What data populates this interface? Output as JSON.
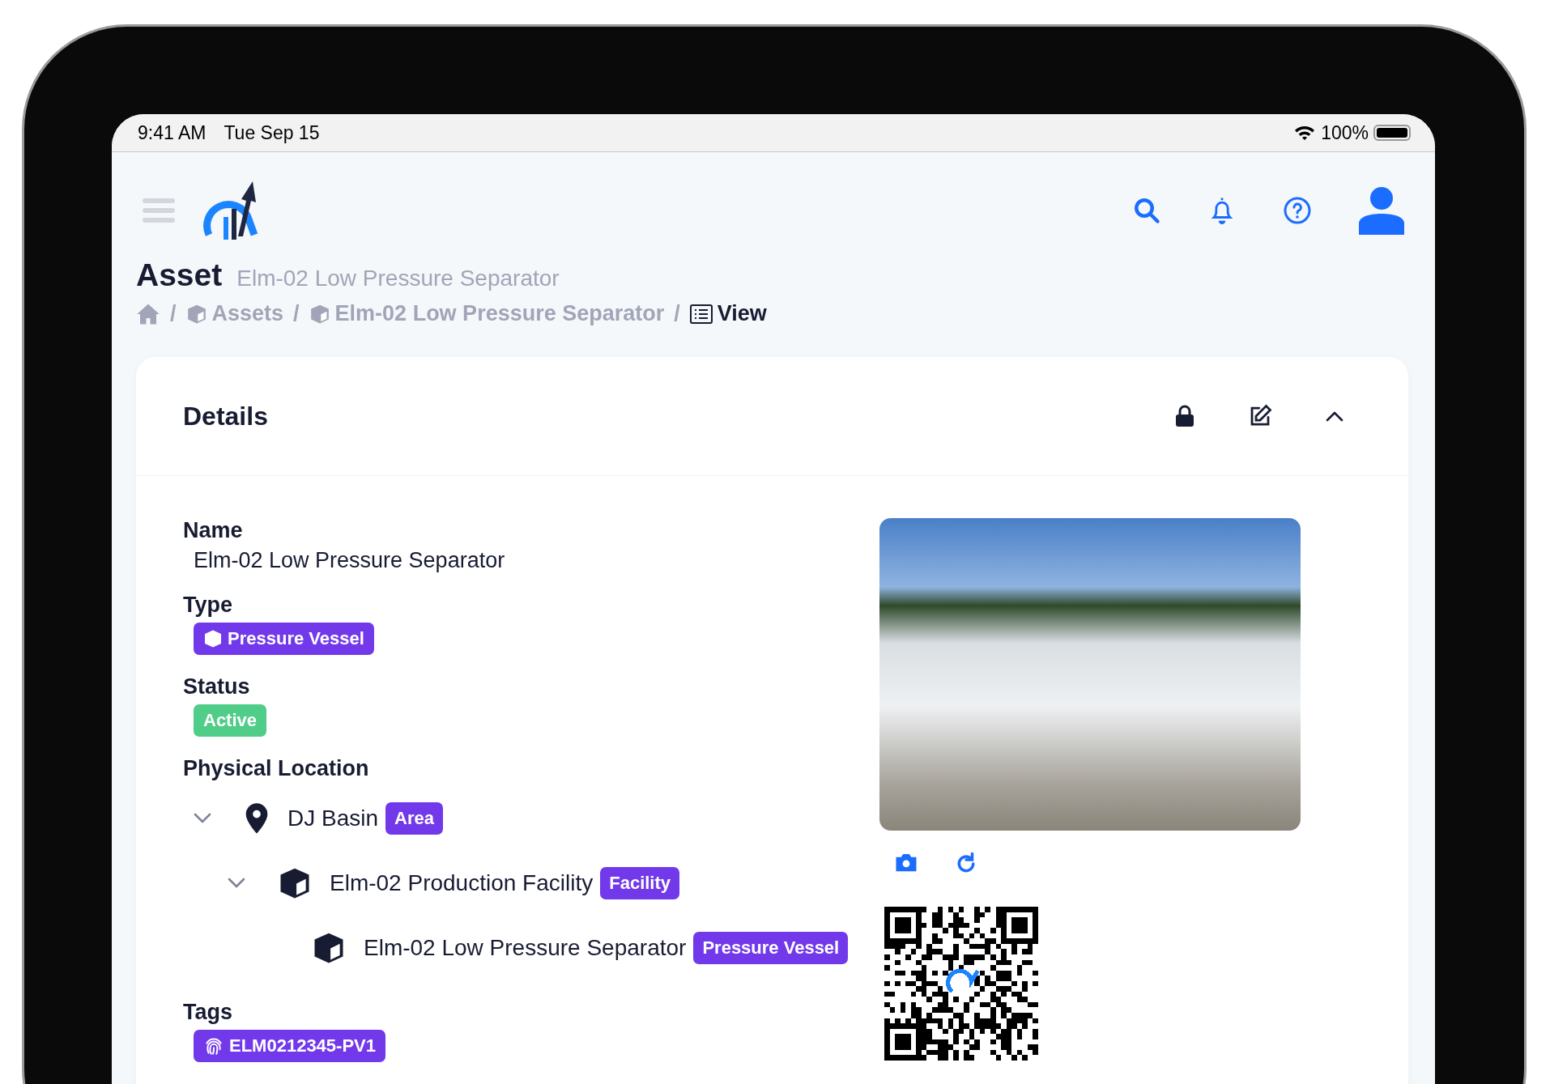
{
  "status_bar": {
    "time": "9:41 AM",
    "date": "Tue Sep 15",
    "battery": "100%"
  },
  "page": {
    "title": "Asset",
    "subtitle": "Elm-02 Low Pressure Separator"
  },
  "breadcrumb": [
    {
      "kind": "home",
      "current": false
    },
    {
      "kind": "cube",
      "separator": "/",
      "label": "Assets",
      "current": false
    },
    {
      "kind": "cube",
      "separator": "/",
      "label": "Elm-02 Low Pressure Separator",
      "current": false
    },
    {
      "kind": "list",
      "separator": "/",
      "label": "View",
      "current": true
    }
  ],
  "card": {
    "title": "Details",
    "expanded": true,
    "fields": [
      {
        "kind": "text",
        "label": "Name",
        "value": "Elm-02 Low Pressure Separator"
      },
      {
        "kind": "type",
        "label": "Type",
        "value": "Pressure Vessel"
      },
      {
        "kind": "status",
        "label": "Status",
        "value": "Active"
      },
      {
        "kind": "tree",
        "label": "Physical Location",
        "tree": [
          {
            "kind": "location",
            "name": "DJ Basin",
            "badge": "Area",
            "expanded": true,
            "children": [
              {
                "kind": "asset",
                "name": "Elm-02 Production Facility",
                "badge": "Facility",
                "expanded": true,
                "children": [
                  {
                    "kind": "asset",
                    "name": "Elm-02 Low Pressure Separator",
                    "badge": "Pressure Vessel"
                  }
                ]
              }
            ]
          }
        ]
      },
      {
        "kind": "tag",
        "label": "Tags",
        "value": "ELM0212345-PV1"
      }
    ]
  }
}
